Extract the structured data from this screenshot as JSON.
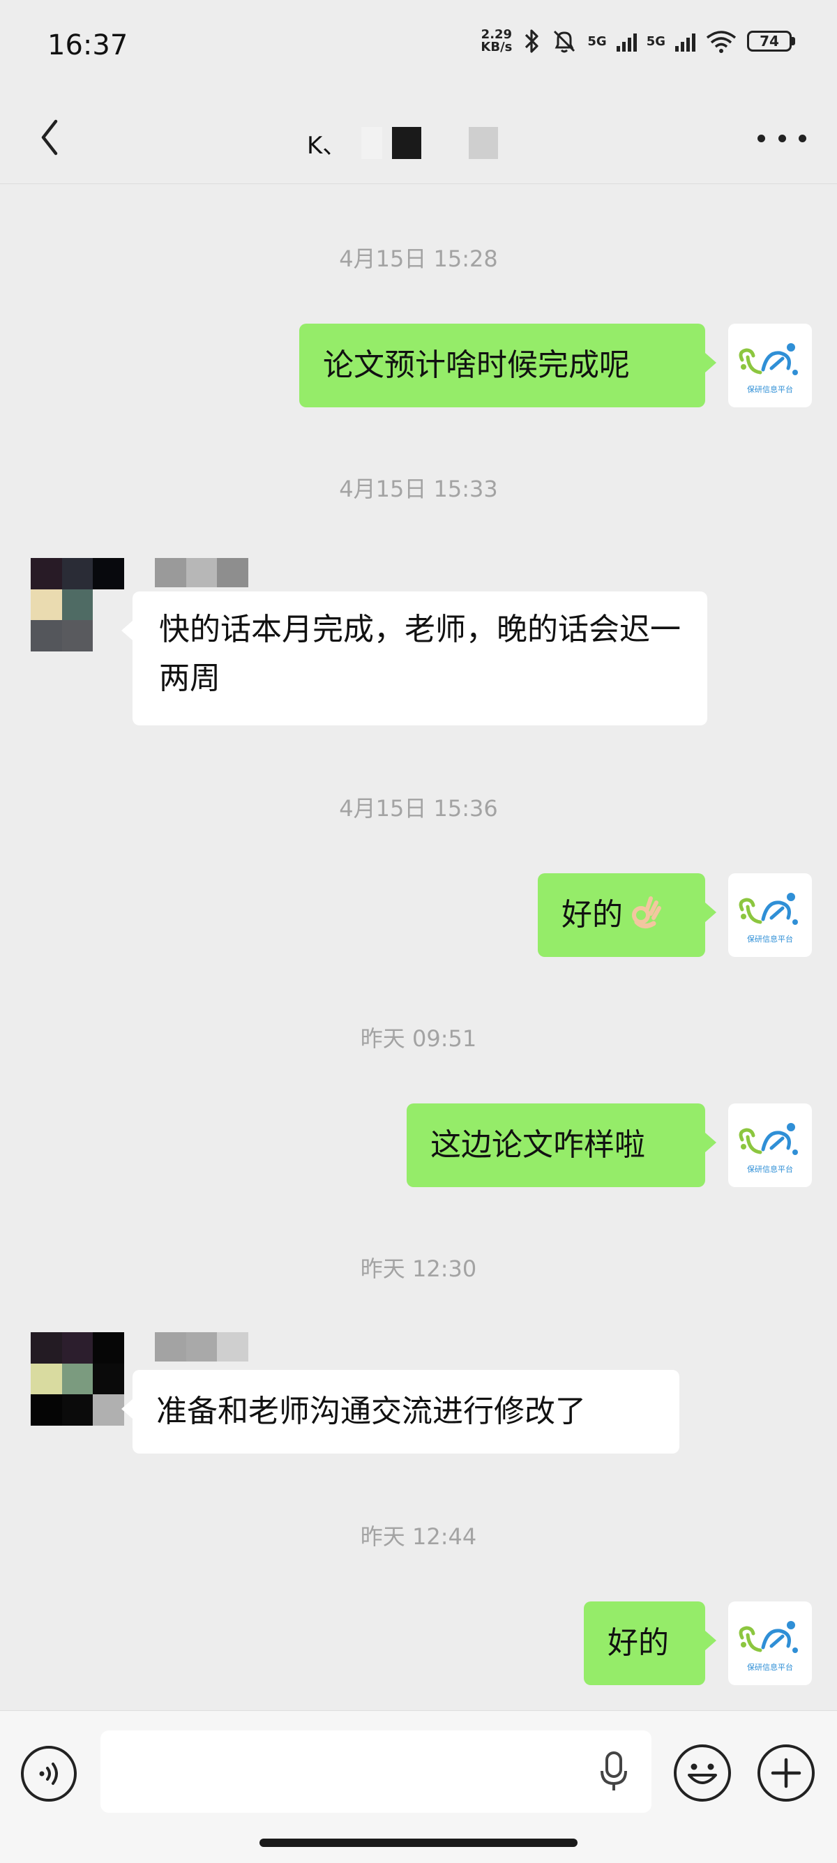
{
  "status_bar": {
    "time": "16:37",
    "net_speed_value": "2.29",
    "net_speed_unit": "KB/s",
    "network_1": "5G",
    "network_2": "5G",
    "battery": "74"
  },
  "header": {
    "title": "K、"
  },
  "messages": [
    {
      "type": "timestamp",
      "text": "4月15日 15:28"
    },
    {
      "type": "outgoing",
      "text": "论文预计啥时候完成呢"
    },
    {
      "type": "timestamp",
      "text": "4月15日 15:33"
    },
    {
      "type": "incoming",
      "text": "快的话本月完成，老师，晚的话会迟一两周"
    },
    {
      "type": "timestamp",
      "text": "4月15日 15:36"
    },
    {
      "type": "outgoing",
      "text": "好的",
      "emoji": "ok-hand-emoji"
    },
    {
      "type": "timestamp",
      "text": "昨天 09:51"
    },
    {
      "type": "outgoing",
      "text": "这边论文咋样啦"
    },
    {
      "type": "timestamp",
      "text": "昨天 12:30"
    },
    {
      "type": "incoming",
      "text": "准备和老师沟通交流进行修改了"
    },
    {
      "type": "timestamp",
      "text": "昨天 12:44"
    },
    {
      "type": "outgoing",
      "text": "好的"
    }
  ],
  "avatar_out": {
    "caption": "保研信息平台"
  },
  "input_bar": {
    "value": "",
    "icons": [
      "voice-icon",
      "microphone-icon",
      "emoji-icon",
      "plus-icon"
    ]
  },
  "colors": {
    "background": "#ededed",
    "outgoing_bubble": "#95ec69",
    "incoming_bubble": "#ffffff",
    "timestamp_text": "#a3a3a3",
    "logo_green": "#8cc63f",
    "logo_blue": "#2f8fd6"
  }
}
